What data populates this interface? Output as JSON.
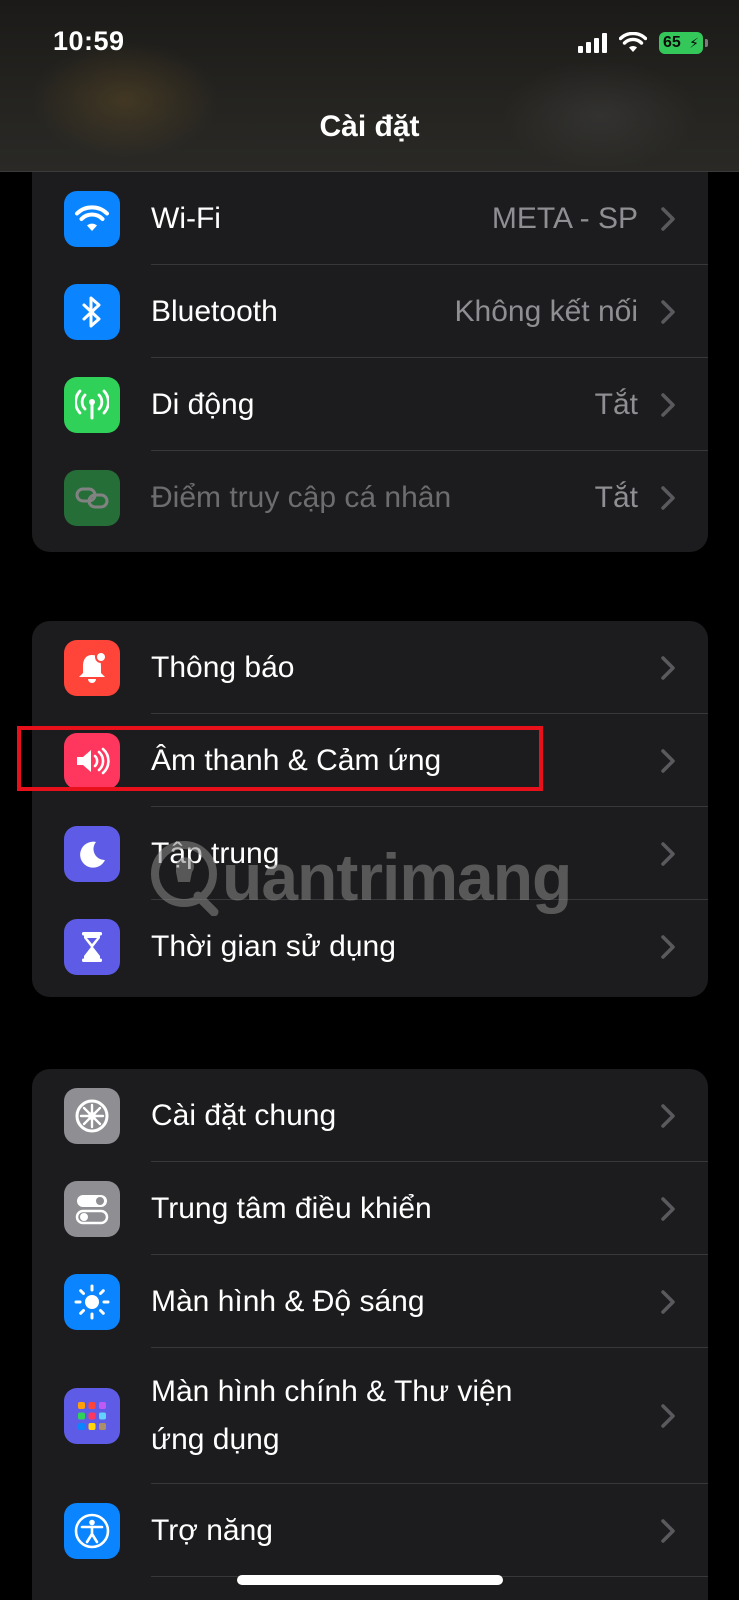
{
  "status_bar": {
    "time": "10:59",
    "battery": "65"
  },
  "header": {
    "title": "Cài đặt"
  },
  "groups": [
    {
      "items": [
        {
          "label": "Wi-Fi",
          "value": "META - SP",
          "icon": "wifi-icon",
          "color": "#0a84ff"
        },
        {
          "label": "Bluetooth",
          "value": "Không kết nối",
          "icon": "bluetooth-icon",
          "color": "#0a84ff"
        },
        {
          "label": "Di động",
          "value": "Tắt",
          "icon": "cellular-antenna-icon",
          "color": "#30d158"
        },
        {
          "label": "Điểm truy cập cá nhân",
          "value": "Tắt",
          "icon": "personal-hotspot-icon",
          "color": "#30d158"
        }
      ]
    },
    {
      "items": [
        {
          "label": "Thông báo",
          "icon": "bell-icon",
          "color": "#ff453a"
        },
        {
          "label": "Âm thanh & Cảm ứng",
          "icon": "speaker-icon",
          "color": "#ff375f"
        },
        {
          "label": "Tập trung",
          "icon": "moon-icon",
          "color": "#5e5ce6"
        },
        {
          "label": "Thời gian sử dụng",
          "icon": "hourglass-icon",
          "color": "#5e5ce6"
        }
      ]
    },
    {
      "items": [
        {
          "label": "Cài đặt chung",
          "icon": "gear-icon",
          "color": "#8e8e93"
        },
        {
          "label": "Trung tâm điều khiển",
          "icon": "toggles-icon",
          "color": "#8e8e93"
        },
        {
          "label": "Màn hình & Độ sáng",
          "icon": "sun-icon",
          "color": "#0a84ff"
        },
        {
          "label_line1": "Màn hình chính & Thư viện",
          "label_line2": "ứng dụng",
          "icon": "app-grid-icon",
          "color": "#5e5ce6"
        },
        {
          "label": "Trợ năng",
          "icon": "accessibility-icon",
          "color": "#0a84ff"
        }
      ]
    }
  ],
  "watermark": {
    "text": "uantrimang"
  }
}
